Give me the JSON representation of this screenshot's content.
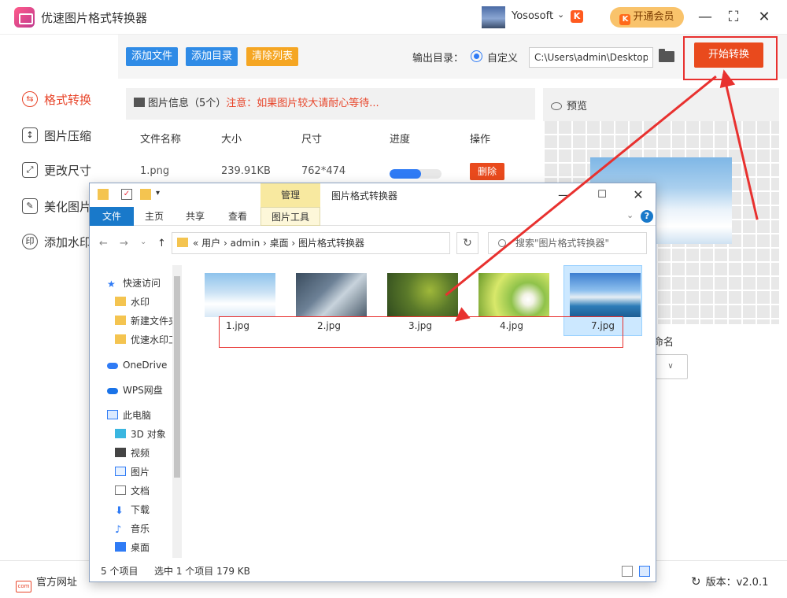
{
  "app": {
    "title": "优速图片格式转换器",
    "user_name": "Yososoft",
    "user_badge": "K",
    "vip_label": "开通会员",
    "vip_icon": "K"
  },
  "nav": [
    {
      "label": "格式转换",
      "icon": "format-convert-icon",
      "active": true
    },
    {
      "label": "图片压缩",
      "icon": "compress-icon",
      "active": false
    },
    {
      "label": "更改尺寸",
      "icon": "resize-icon",
      "active": false
    },
    {
      "label": "美化图片",
      "icon": "beautify-icon",
      "active": false
    },
    {
      "label": "添加水印",
      "icon": "watermark-icon",
      "active": false
    }
  ],
  "toolbar": {
    "add_file": "添加文件",
    "add_dir": "添加目录",
    "clear_list": "清除列表",
    "output_label": "输出目录：",
    "radio_label": "自定义",
    "output_path": "C:\\Users\\admin\\Desktop",
    "start": "开始转换",
    "colors": {
      "blue": "#2f8be6",
      "orange": "#f5a623",
      "start": "#e94a1d"
    }
  },
  "list": {
    "header_title": "图片信息（5个）",
    "header_warning": "注意：如果图片较大请耐心等待...",
    "columns": [
      "文件名称",
      "大小",
      "尺寸",
      "进度",
      "操作"
    ],
    "rows": [
      {
        "name": "1.png",
        "size": "239.91KB",
        "dimensions": "762*474",
        "progress": 0.6,
        "action": "删除"
      }
    ]
  },
  "preview": {
    "title": "预览",
    "rename_label": "命名",
    "rename_select": "∨"
  },
  "bottom": {
    "official_site": "官方网址",
    "official_icon": "com",
    "version": "版本：v2.0.1"
  },
  "explorer": {
    "manage_tab": "管理",
    "window_title": "图片格式转换器",
    "tabs": [
      "文件",
      "主页",
      "共享",
      "查看",
      "图片工具"
    ],
    "address": "« 用户 › admin › 桌面 › 图片格式转换器",
    "search_placeholder": "搜索\"图片格式转换器\"",
    "sidebar": [
      {
        "label": "快速访问",
        "icon": "star-icon"
      },
      {
        "label": "水印",
        "icon": "folder-icon"
      },
      {
        "label": "新建文件夹",
        "icon": "folder-icon"
      },
      {
        "label": "优速水印工",
        "icon": "folder-icon"
      },
      {
        "label": "OneDrive",
        "icon": "cloud-icon"
      },
      {
        "label": "WPS网盘",
        "icon": "wps-cloud-icon"
      },
      {
        "label": "此电脑",
        "icon": "computer-icon"
      },
      {
        "label": "3D 对象",
        "icon": "cube-icon"
      },
      {
        "label": "视频",
        "icon": "video-icon"
      },
      {
        "label": "图片",
        "icon": "picture-icon"
      },
      {
        "label": "文档",
        "icon": "document-icon"
      },
      {
        "label": "下载",
        "icon": "download-icon"
      },
      {
        "label": "音乐",
        "icon": "music-icon"
      },
      {
        "label": "桌面",
        "icon": "desktop-icon"
      }
    ],
    "files": [
      {
        "name": "1.jpg",
        "thumb": "sky-clouds"
      },
      {
        "name": "2.jpg",
        "thumb": "laptop-desk"
      },
      {
        "name": "3.jpg",
        "thumb": "green-plants"
      },
      {
        "name": "4.jpg",
        "thumb": "daisy-field"
      },
      {
        "name": "7.jpg",
        "thumb": "lake-boats",
        "selected": true
      }
    ],
    "status_count": "5 个项目",
    "status_selected": "选中 1 个项目  179 KB"
  }
}
